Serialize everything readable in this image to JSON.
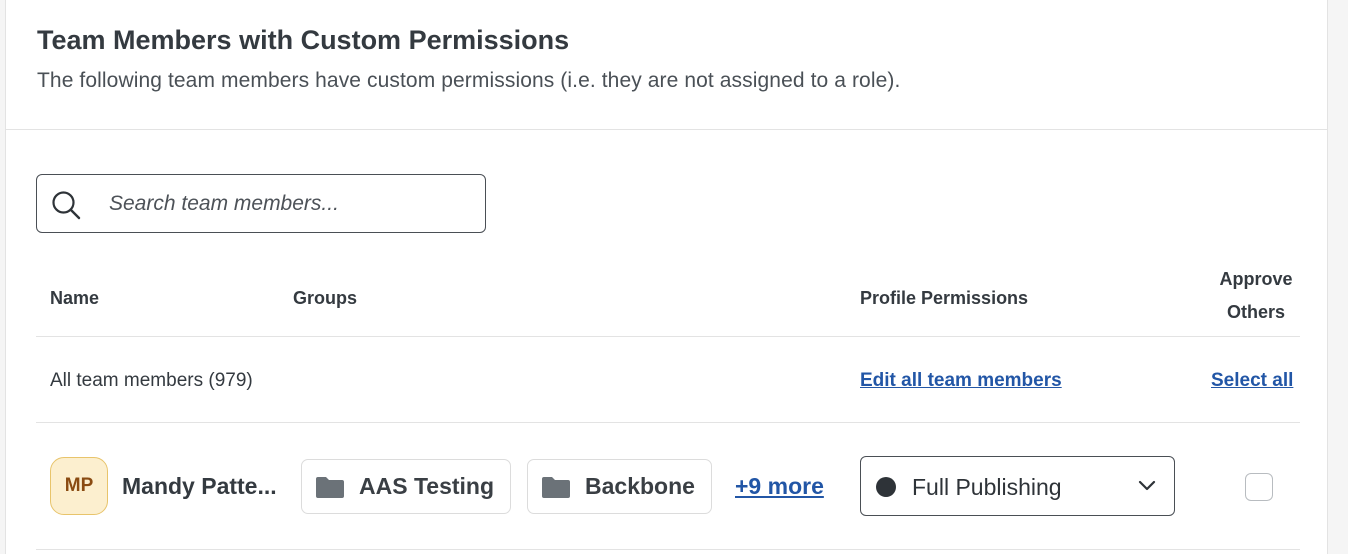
{
  "header": {
    "title": "Team Members with Custom Permissions",
    "subtitle": "The following team members have custom permissions (i.e. they are not assigned to a role)."
  },
  "search": {
    "placeholder": "Search team members...",
    "value": "",
    "icon": "search-icon"
  },
  "table": {
    "columns": {
      "name": "Name",
      "groups": "Groups",
      "profile_permissions": "Profile Permissions",
      "approve_line1": "Approve",
      "approve_line2": "Others"
    },
    "all_row": {
      "label": "All team members (979)",
      "edit_all_link": "Edit all team members",
      "select_all_link": "Select all"
    },
    "rows": [
      {
        "initials": "MP",
        "name": "Mandy Patte...",
        "groups": [
          "AAS Testing",
          "Backbone"
        ],
        "more_link": "+9 more",
        "permission": "Full Publishing",
        "approve_checked": false
      }
    ]
  },
  "colors": {
    "link": "#2256a6",
    "avatar_bg": "#fcefcf",
    "avatar_text": "#8a4b12",
    "text": "#343a40"
  }
}
